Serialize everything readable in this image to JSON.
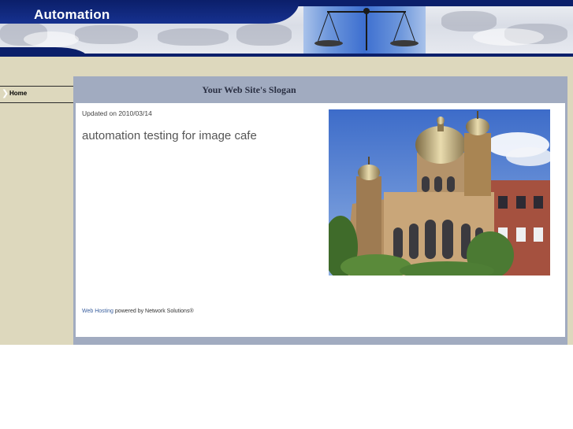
{
  "header": {
    "site_title": "Automation"
  },
  "nav": {
    "items": [
      {
        "label": "Home",
        "arrow_icon": "chevron-right-icon"
      }
    ]
  },
  "content": {
    "slogan": "Your Web Site's Slogan",
    "updated": "Updated on 2010/03/14",
    "main_text": "automation testing for image cafe",
    "photo_subject": "domed-synagogue-building"
  },
  "footer": {
    "link_text": "Web Hosting",
    "suffix_text": "powered by Network Solutions®"
  },
  "colors": {
    "header_navy": "#0b1f6a",
    "tan_background": "#ddd8bd",
    "frame_grey_blue": "#a1abc0",
    "link_blue": "#3a5f9e"
  }
}
